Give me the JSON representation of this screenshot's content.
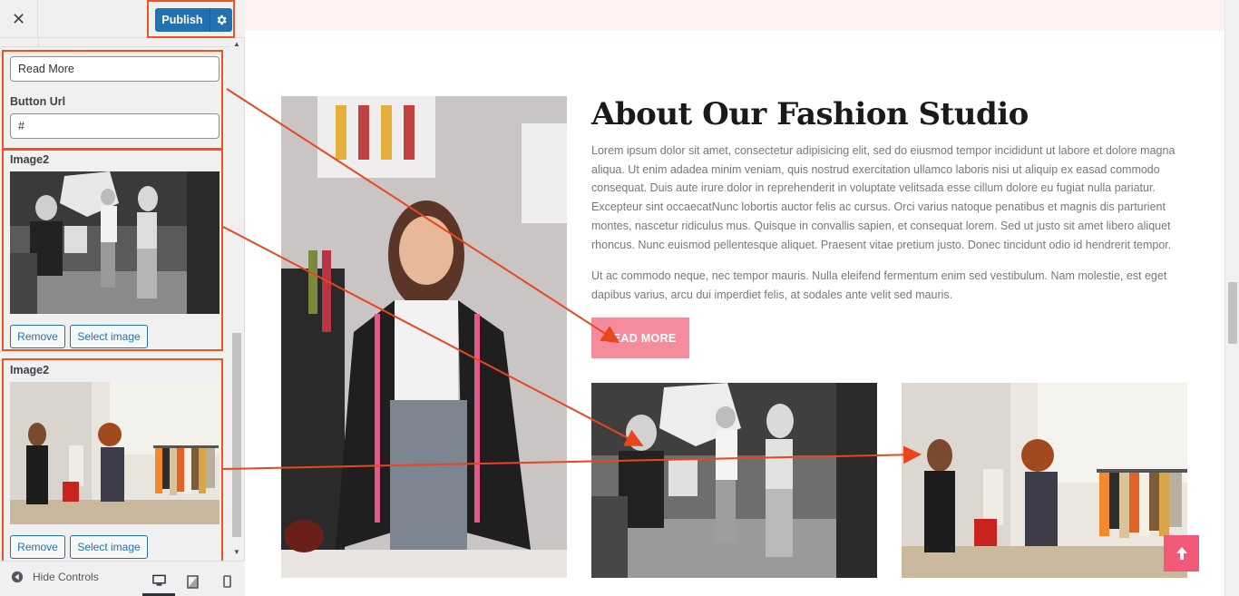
{
  "panel": {
    "close_glyph": "✕",
    "publish_label": "Publish",
    "fields": {
      "button_text_value": "Read More",
      "button_url_label": "Button Url",
      "button_url_value": "#"
    },
    "image_sections": [
      {
        "label": "Image2",
        "remove_label": "Remove",
        "select_label": "Select image"
      },
      {
        "label": "Image2",
        "remove_label": "Remove",
        "select_label": "Select image"
      }
    ],
    "footer": {
      "hide_controls_label": "Hide Controls"
    }
  },
  "preview": {
    "title": "About Our Fashion Studio",
    "paragraph_1": "Lorem ipsum dolor sit amet, consectetur adipisicing elit, sed do eiusmod tempor incididunt ut labore et dolore magna aliqua. Ut enim adadea minim veniam, quis nostrud exercitation ullamco laboris nisi ut aliquip ex easad commodo consequat. Duis aute irure dolor in reprehenderit in voluptate velitsada esse cillum dolore eu fugiat nulla pariatur. Excepteur sint occaecatNunc lobortis auctor felis ac cursus. Orci varius natoque penatibus et magnis dis parturient montes, nascetur ridiculus mus. Quisque in convallis sapien, et consequat lorem. Sed ut justo sit amet libero aliquet rhoncus. Nunc euismod pellentesque aliquet. Praesent vitae pretium justo. Donec tincidunt odio id hendrerit tempor.",
    "paragraph_2": "Ut ac commodo neque, nec tempor mauris. Nulla eleifend fermentum enim sed vestibulum. Nam molestie, est eget dapibus varius, arcu dui imperdiet felis, at sodales ante velit sed mauris.",
    "read_more_label": "READ MORE"
  },
  "colors": {
    "publish_blue": "#2271b1",
    "highlight_orange": "#f0541e",
    "read_more_pink": "#f58c9d",
    "to_top_pink": "#f05a78",
    "top_band": "#fdf1f2"
  },
  "icons": {
    "close": "close-icon",
    "publish_settings": "gear-icon",
    "hide_controls": "collapse-arrow-icon",
    "desktop": "desktop-icon",
    "tablet": "tablet-icon",
    "mobile": "mobile-icon",
    "back_to_top": "arrow-up-icon"
  }
}
